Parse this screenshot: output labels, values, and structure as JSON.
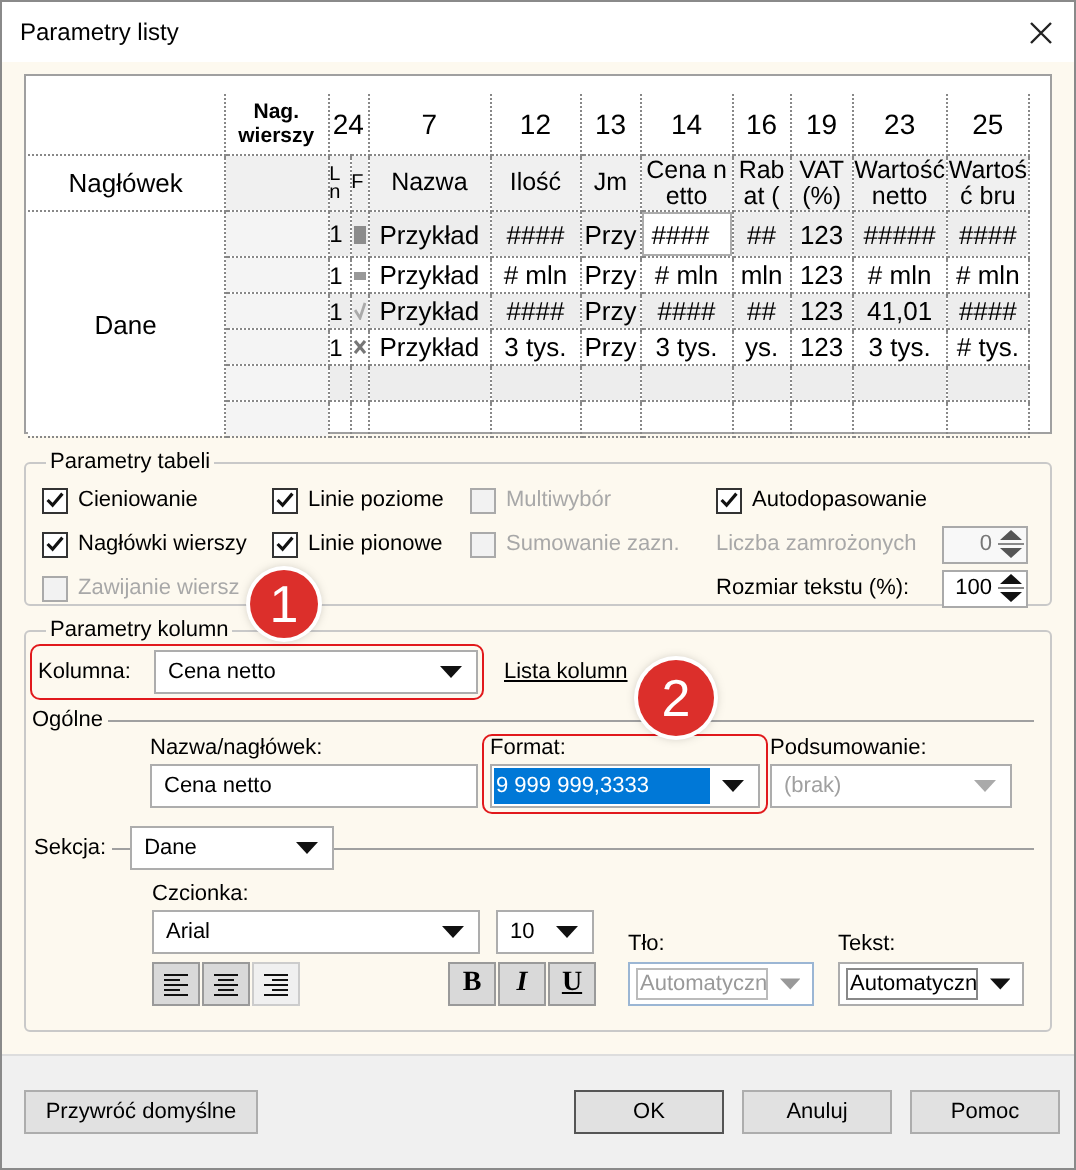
{
  "window": {
    "title": "Parametry listy"
  },
  "preview": {
    "row_header_title": "Nag. wierszy",
    "header_label": "Nagłówek",
    "data_label": "Dane",
    "columns": [
      {
        "number": "24",
        "header": "L n"
      },
      {
        "header": "F"
      },
      {
        "number": "7",
        "header": "Nazwa"
      },
      {
        "number": "12",
        "header": "Ilość"
      },
      {
        "number": "13",
        "header": "Jm"
      },
      {
        "number": "14",
        "header": "Cena netto"
      },
      {
        "number": "16",
        "header": "Rabat ("
      },
      {
        "number": "19",
        "header": "VAT (%)"
      },
      {
        "number": "23",
        "header": "Wartość netto"
      },
      {
        "number": "25",
        "header": "Wartość bru"
      }
    ],
    "rows": [
      {
        "shaded": true,
        "number": "1",
        "marker": {
          "kind": "square"
        },
        "cells": [
          {
            "text": "Przykład",
            "selected": false
          },
          {
            "text": "####",
            "selected": false
          },
          {
            "text": "Przy",
            "selected": false
          },
          {
            "text": "####",
            "selected": true
          },
          {
            "text": "##",
            "selected": false
          },
          {
            "text": "123",
            "selected": false
          },
          {
            "text": "#####",
            "selected": false
          },
          {
            "text": "####",
            "selected": false
          }
        ]
      },
      {
        "shaded": false,
        "number": "1",
        "marker": {
          "kind": "dash"
        },
        "cells": [
          {
            "text": "Przykład",
            "selected": false
          },
          {
            "text": "# mln",
            "selected": false
          },
          {
            "text": "Przy",
            "selected": false
          },
          {
            "text": "# mln",
            "selected": false
          },
          {
            "text": "mln",
            "selected": false
          },
          {
            "text": "123",
            "selected": false
          },
          {
            "text": "# mln",
            "selected": false
          },
          {
            "text": "# mln",
            "selected": false
          }
        ]
      },
      {
        "shaded": true,
        "number": "1",
        "marker": {
          "kind": "check"
        },
        "cells": [
          {
            "text": "Przykład",
            "selected": false
          },
          {
            "text": "####",
            "selected": false
          },
          {
            "text": "Przy",
            "selected": false
          },
          {
            "text": "####",
            "selected": false
          },
          {
            "text": "##",
            "selected": false
          },
          {
            "text": "123",
            "selected": false
          },
          {
            "text": "41,01",
            "selected": false
          },
          {
            "text": "####",
            "selected": false
          }
        ]
      },
      {
        "shaded": false,
        "number": "1",
        "marker": {
          "kind": "cross"
        },
        "cells": [
          {
            "text": "Przykład",
            "selected": false
          },
          {
            "text": "3 tys.",
            "selected": false
          },
          {
            "text": "Przy",
            "selected": false
          },
          {
            "text": "3 tys.",
            "selected": false
          },
          {
            "text": "ys.",
            "selected": false
          },
          {
            "text": "123",
            "selected": false
          },
          {
            "text": "3 tys.",
            "selected": false
          },
          {
            "text": "# tys.",
            "selected": false
          }
        ]
      },
      {
        "shaded": true
      },
      {
        "shaded": false
      }
    ]
  },
  "table_params": {
    "title": "Parametry tabeli",
    "options": [
      {
        "label": "Cieniowanie",
        "checked": true,
        "disabled": false
      },
      {
        "label": "Linie poziome",
        "checked": true,
        "disabled": false
      },
      {
        "label": "Multiwybór",
        "checked": false,
        "disabled": true
      },
      {
        "label": "Nagłówki wierszy",
        "checked": true,
        "disabled": false
      },
      {
        "label": "Linie pionowe",
        "checked": true,
        "disabled": false
      },
      {
        "label": "Sumowanie zazn.",
        "checked": false,
        "disabled": true
      },
      {
        "label": "Zawijanie wiersz",
        "checked": false,
        "disabled": true
      }
    ],
    "autofit": {
      "label": "Autodopasowanie",
      "checked": true
    },
    "spinners": [
      {
        "label": "Liczba zamrożonych",
        "value": "0",
        "disabled": true
      },
      {
        "label": "Rozmiar tekstu (%):",
        "value": "100",
        "disabled": false
      }
    ]
  },
  "column_params": {
    "title": "Parametry kolumn",
    "column": {
      "label": "Kolumna:",
      "value": "Cena netto",
      "highlighted": true
    },
    "list_link": "Lista kolumn",
    "general_title": "Ogólne",
    "name": {
      "label": "Nazwa/nagłówek:",
      "value": "Cena netto"
    },
    "format": {
      "label": "Format:",
      "value": "9 999 999,3333",
      "highlighted": true
    },
    "summary": {
      "label": "Podsumowanie:",
      "value": "(brak)",
      "disabled": true
    },
    "section": {
      "label": "Sekcja:",
      "value": "Dane"
    },
    "font": {
      "label": "Czcionka:",
      "family": "Arial",
      "size": "10"
    },
    "alignment": [
      {
        "kind": "left",
        "selected": false
      },
      {
        "kind": "center",
        "selected": false
      },
      {
        "kind": "right",
        "selected": true
      }
    ],
    "styles": [
      {
        "kind": "bold",
        "label": "B"
      },
      {
        "kind": "italic",
        "label": "I"
      },
      {
        "kind": "underline",
        "label": "U"
      }
    ],
    "background": {
      "label": "Tło:",
      "value": "Automatyczn",
      "disabled": true
    },
    "text_color": {
      "label": "Tekst:",
      "value": "Automatyczn",
      "disabled": false
    }
  },
  "callouts": [
    "1",
    "2"
  ],
  "buttons": [
    {
      "label": "Przywróć domyślne",
      "kind": "reset"
    },
    {
      "label": "OK",
      "kind": "default"
    },
    {
      "label": "Anuluj",
      "kind": "normal"
    },
    {
      "label": "Pomoc",
      "kind": "normal"
    }
  ]
}
